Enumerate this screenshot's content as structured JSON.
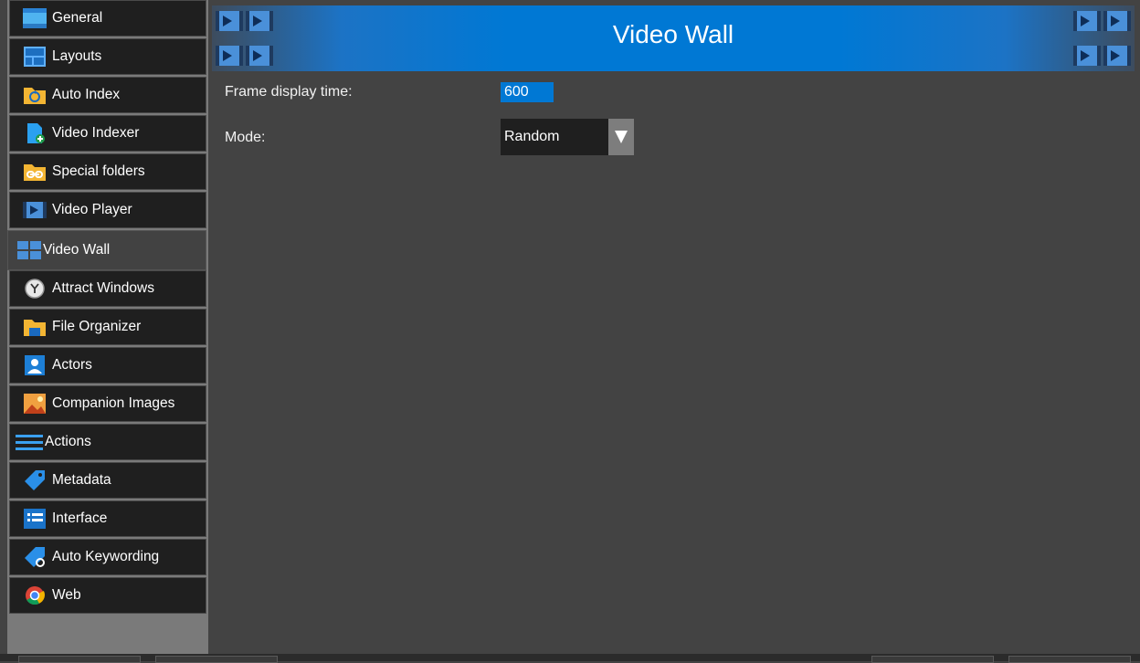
{
  "sidebar": {
    "items": [
      {
        "label": "General",
        "icon": "general-icon"
      },
      {
        "label": "Layouts",
        "icon": "layouts-icon"
      },
      {
        "label": "Auto Index",
        "icon": "auto-index-folder-icon"
      },
      {
        "label": "Video Indexer",
        "icon": "video-indexer-file-icon"
      },
      {
        "label": "Special folders",
        "icon": "special-folder-link-icon"
      },
      {
        "label": "Video Player",
        "icon": "video-player-film-icon"
      },
      {
        "label": "Video Wall",
        "icon": "video-wall-grid-icon",
        "active": true
      },
      {
        "label": "Attract Windows",
        "icon": "clock-icon"
      },
      {
        "label": "File Organizer",
        "icon": "file-organizer-folder-icon"
      },
      {
        "label": "Actors",
        "icon": "actor-person-icon"
      },
      {
        "label": "Companion Images",
        "icon": "image-picture-icon"
      },
      {
        "label": "Actions",
        "icon": "actions-lines-icon"
      },
      {
        "label": "Metadata",
        "icon": "tag-icon"
      },
      {
        "label": "Interface",
        "icon": "interface-list-icon"
      },
      {
        "label": "Auto Keywording",
        "icon": "auto-keyword-tag-icon"
      },
      {
        "label": "Web",
        "icon": "chrome-browser-icon"
      }
    ]
  },
  "header": {
    "title": "Video Wall"
  },
  "settings": {
    "frame_display_time_label": "Frame display time:",
    "frame_display_time_value": "600",
    "mode_label": "Mode:",
    "mode_value": "Random"
  },
  "colors": {
    "accent": "#0078d4",
    "background": "#434343",
    "sidebar_item": "#1f1f1f",
    "sidebar_gray": "#7a7a7a"
  }
}
